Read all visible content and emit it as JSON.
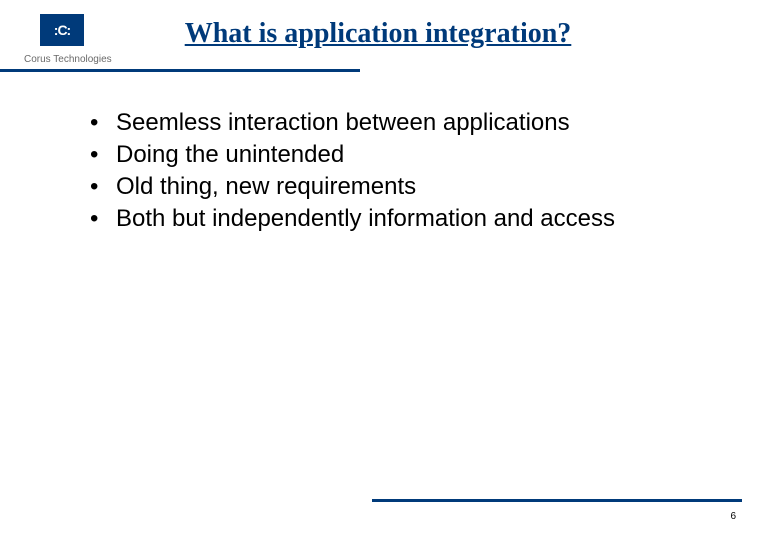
{
  "brand": {
    "glyph": ":C:",
    "company": "Corus Technologies"
  },
  "title": "What is application integration?",
  "bullets": [
    "Seemless interaction between applications",
    "Doing the unintended",
    "Old thing, new requirements",
    "Both but independently information and access"
  ],
  "page_number": "6"
}
